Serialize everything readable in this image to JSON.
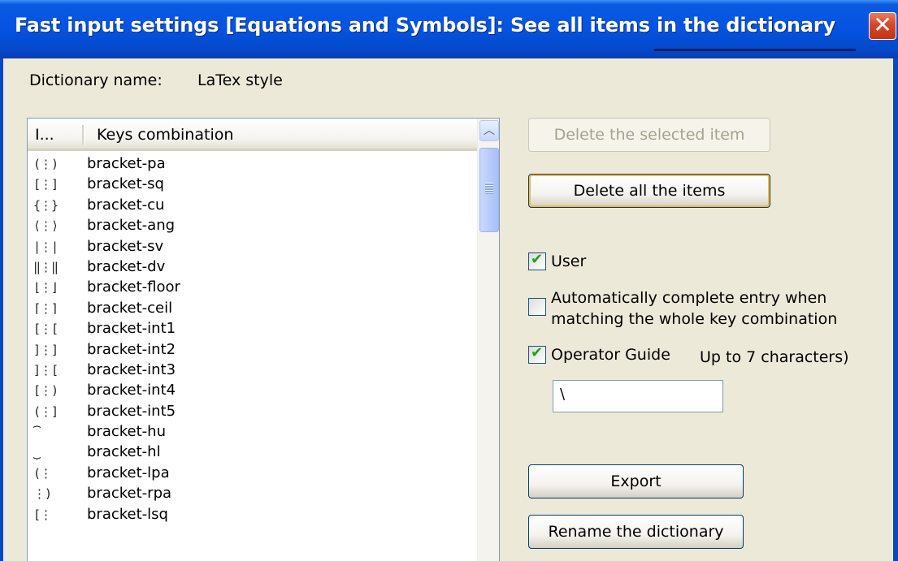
{
  "window": {
    "title": "Fast input settings [Equations and Symbols]: See all items in the dictionary",
    "close_glyph": "✕"
  },
  "dictionary": {
    "name_label": "Dictionary name:",
    "name_value": "LaTex style"
  },
  "list": {
    "headers": [
      "I...",
      "Keys combination"
    ],
    "rows": [
      {
        "icon": "(⋮)",
        "key": "bracket-pa"
      },
      {
        "icon": "[⋮]",
        "key": "bracket-sq"
      },
      {
        "icon": "{⋮}",
        "key": "bracket-cu"
      },
      {
        "icon": "⟨⋮⟩",
        "key": "bracket-ang"
      },
      {
        "icon": "|⋮|",
        "key": "bracket-sv"
      },
      {
        "icon": "‖⋮‖",
        "key": "bracket-dv"
      },
      {
        "icon": "⌊⋮⌋",
        "key": "bracket-floor"
      },
      {
        "icon": "⌈⋮⌉",
        "key": "bracket-ceil"
      },
      {
        "icon": "[⋮[",
        "key": "bracket-int1"
      },
      {
        "icon": "]⋮]",
        "key": "bracket-int2"
      },
      {
        "icon": "]⋮[",
        "key": "bracket-int3"
      },
      {
        "icon": "[⋮)",
        "key": "bracket-int4"
      },
      {
        "icon": "(⋮]",
        "key": "bracket-int5"
      },
      {
        "icon": "⏞",
        "key": "bracket-hu"
      },
      {
        "icon": "⏟",
        "key": "bracket-hl"
      },
      {
        "icon": "(⋮",
        "key": "bracket-lpa"
      },
      {
        "icon": "⋮)",
        "key": "bracket-rpa"
      },
      {
        "icon": "[⋮",
        "key": "bracket-lsq"
      }
    ]
  },
  "buttons": {
    "delete_selected": "Delete the selected item",
    "delete_all": "Delete all the items",
    "export": "Export",
    "rename": "Rename the dictionary"
  },
  "options": {
    "user_label": "User",
    "user_checked": true,
    "autocomplete_label_line1": "Automatically complete entry when",
    "autocomplete_label_line2": "matching the whole key combination",
    "autocomplete_checked": false,
    "operator_guide_label": "Operator Guide",
    "operator_guide_checked": true,
    "operator_guide_hint": "Up to 7 characters)",
    "operator_guide_value": "\\"
  },
  "icons": {
    "checkmark": "✔",
    "scroll_up": "︿"
  }
}
